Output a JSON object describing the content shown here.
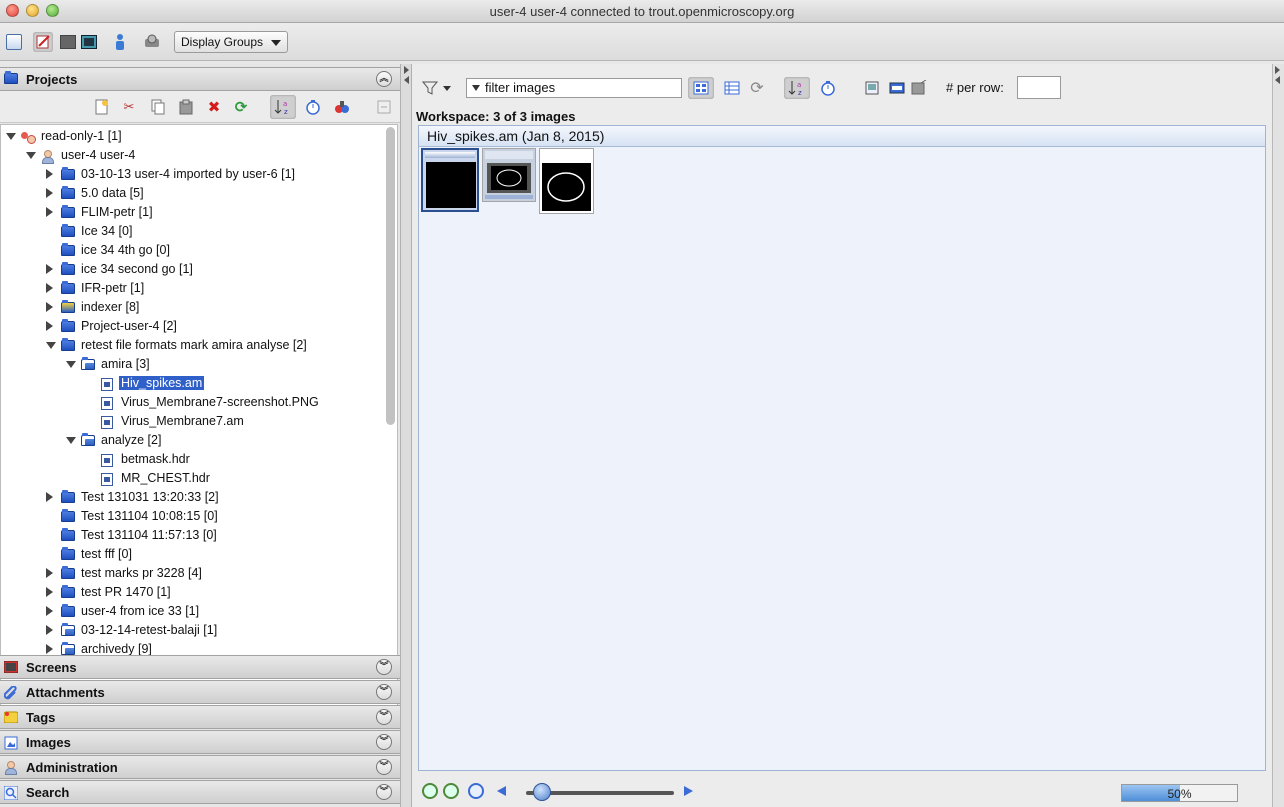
{
  "window": {
    "title": "user-4 user-4 connected to trout.openmicroscopy.org"
  },
  "toolbar": {
    "display_groups_label": "Display Groups"
  },
  "left_panel": {
    "sections": [
      {
        "label": "Projects",
        "expanded": true
      },
      {
        "label": "Screens",
        "expanded": false
      },
      {
        "label": "Attachments",
        "expanded": false
      },
      {
        "label": "Tags",
        "expanded": false
      },
      {
        "label": "Images",
        "expanded": false
      },
      {
        "label": "Administration",
        "expanded": false
      },
      {
        "label": "Search",
        "expanded": false
      }
    ],
    "tree": [
      {
        "label": "read-only-1 [1]",
        "depth": 0,
        "type": "group",
        "toggle": "open"
      },
      {
        "label": "user-4 user-4",
        "depth": 1,
        "type": "user",
        "toggle": "open"
      },
      {
        "label": "03-10-13 user-4 imported by user-6 [1]",
        "depth": 2,
        "type": "project",
        "toggle": "closed"
      },
      {
        "label": "5.0 data [5]",
        "depth": 2,
        "type": "project",
        "toggle": "closed"
      },
      {
        "label": "FLIM-petr [1]",
        "depth": 2,
        "type": "project",
        "toggle": "closed"
      },
      {
        "label": "Ice 34 [0]",
        "depth": 2,
        "type": "project",
        "toggle": "none"
      },
      {
        "label": "ice 34 4th go [0]",
        "depth": 2,
        "type": "project",
        "toggle": "none"
      },
      {
        "label": "ice 34 second go [1]",
        "depth": 2,
        "type": "project",
        "toggle": "closed"
      },
      {
        "label": "IFR-petr [1]",
        "depth": 2,
        "type": "project",
        "toggle": "closed"
      },
      {
        "label": "indexer [8]",
        "depth": 2,
        "type": "project-tagged",
        "toggle": "closed"
      },
      {
        "label": "Project-user-4 [2]",
        "depth": 2,
        "type": "project",
        "toggle": "closed"
      },
      {
        "label": "retest file formats mark amira analyse [2]",
        "depth": 2,
        "type": "project",
        "toggle": "open"
      },
      {
        "label": "amira [3]",
        "depth": 3,
        "type": "dataset",
        "toggle": "open"
      },
      {
        "label": "Hiv_spikes.am",
        "depth": 4,
        "type": "image",
        "toggle": "none",
        "selected": true
      },
      {
        "label": "Virus_Membrane7-screenshot.PNG",
        "depth": 4,
        "type": "image",
        "toggle": "none"
      },
      {
        "label": "Virus_Membrane7.am",
        "depth": 4,
        "type": "image",
        "toggle": "none"
      },
      {
        "label": "analyze [2]",
        "depth": 3,
        "type": "dataset",
        "toggle": "open"
      },
      {
        "label": "betmask.hdr",
        "depth": 4,
        "type": "image",
        "toggle": "none"
      },
      {
        "label": "MR_CHEST.hdr",
        "depth": 4,
        "type": "image",
        "toggle": "none"
      },
      {
        "label": "Test 131031 13:20:33 [2]",
        "depth": 2,
        "type": "project",
        "toggle": "closed"
      },
      {
        "label": "Test 131104 10:08:15 [0]",
        "depth": 2,
        "type": "project",
        "toggle": "none"
      },
      {
        "label": "Test 131104 11:57:13 [0]",
        "depth": 2,
        "type": "project",
        "toggle": "none"
      },
      {
        "label": "test fff [0]",
        "depth": 2,
        "type": "project",
        "toggle": "none"
      },
      {
        "label": "test marks pr 3228 [4]",
        "depth": 2,
        "type": "project",
        "toggle": "closed"
      },
      {
        "label": "test PR  1470 [1]",
        "depth": 2,
        "type": "project",
        "toggle": "closed"
      },
      {
        "label": "user-4 from ice 33 [1]",
        "depth": 2,
        "type": "project",
        "toggle": "closed"
      },
      {
        "label": "03-12-14-retest-balaji [1]",
        "depth": 2,
        "type": "dataset",
        "toggle": "closed"
      },
      {
        "label": "archivedy [9]",
        "depth": 2,
        "type": "dataset",
        "toggle": "closed"
      }
    ]
  },
  "right_panel": {
    "filter_text": "filter  images",
    "per_row_label": "# per row:",
    "per_row_value": "",
    "workspace_label": "Workspace: 3 of 3 images",
    "group_header": "Hiv_spikes.am (Jan 8, 2015)",
    "thumbnails": [
      {
        "name": "Hiv_spikes.am",
        "selected": true
      },
      {
        "name": "Virus_Membrane7-screenshot.PNG",
        "selected": false
      },
      {
        "name": "Virus_Membrane7.am",
        "selected": false
      }
    ],
    "progress_text": "50%",
    "progress_value": 0.5,
    "zoom_slider_value": 0.05
  },
  "colors": {
    "selection": "#2f5fc9",
    "folder": "#2f5fd0"
  }
}
